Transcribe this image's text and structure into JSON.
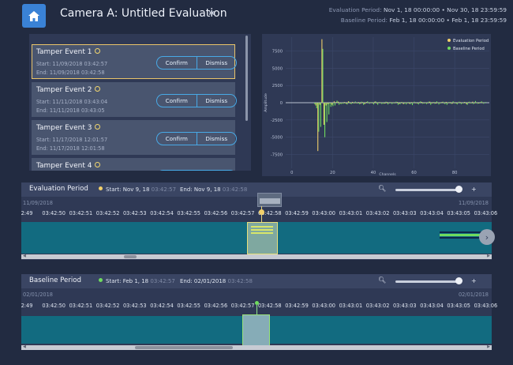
{
  "title": "Camera A: Untitled Evaluation",
  "header": {
    "eval_label": "Evaluation Period:",
    "eval_value": "Nov 1, 18  00:00:00  •  Nov 30, 18  23:59:59",
    "base_label": "Baseline Period:",
    "base_value": "Feb 1, 18  00:00:00  •  Feb 1, 18  23:59:59"
  },
  "events": [
    {
      "title": "Tamper Event 1",
      "start": "Start: 11/09/2018 03:42:57",
      "end": "End:   11/09/2018 03:42:58",
      "confirm": "Confirm",
      "dismiss": "Dismiss",
      "selected": true
    },
    {
      "title": "Tamper Event 2",
      "start": "Start: 11/11/2018 03:43:04",
      "end": "End:   11/11/2018 03:43:05",
      "confirm": "Confirm",
      "dismiss": "Dismiss",
      "selected": false
    },
    {
      "title": "Tamper Event 3",
      "start": "Start: 11/17/2018 12:01:57",
      "end": "End:   11/17/2018 12:01:58",
      "confirm": "Confirm",
      "dismiss": "Dismiss",
      "selected": false
    },
    {
      "title": "Tamper Event 4",
      "start": "",
      "end": "",
      "confirm": "",
      "dismiss": "",
      "selected": false
    }
  ],
  "chart_data": {
    "type": "bar",
    "xlabel": "Channels",
    "ylabel": "Amplitude",
    "xlim": [
      -3,
      97
    ],
    "ylim": [
      -9500,
      9500
    ],
    "xticks": [
      0,
      20,
      40,
      60,
      80
    ],
    "yticks": [
      -7500,
      -5000,
      -2500,
      0,
      2500,
      5000,
      7500
    ],
    "legend_position": "top-right",
    "series": [
      {
        "name": "Evaluation Period",
        "color": "#f2d06b",
        "values": [
          0,
          0,
          0,
          0,
          0,
          0,
          0,
          0,
          0,
          0,
          0,
          0,
          -400,
          -7000,
          -300,
          9200,
          -3200,
          -400,
          -200,
          -100,
          -300,
          200,
          100,
          150,
          -100,
          -50,
          100,
          -150,
          200,
          -100,
          120,
          -80,
          -60,
          100,
          -150,
          80,
          -200,
          100,
          -50,
          60,
          -80,
          150,
          -100,
          80,
          60,
          -50,
          -120,
          100,
          -80,
          60,
          40,
          -60,
          100,
          -150,
          80,
          -200,
          60,
          -40,
          -150,
          80,
          50,
          -60,
          -100,
          80,
          120,
          -80,
          40,
          -60,
          150,
          -100,
          80,
          -120,
          60,
          -40,
          100,
          -80,
          120,
          -60,
          80,
          -150,
          60,
          -100,
          40,
          80,
          -60,
          100,
          -200,
          80,
          -50,
          150,
          -80,
          60,
          -100,
          80,
          40
        ]
      },
      {
        "name": "Baseline Period",
        "color": "#6fdc5e",
        "values": [
          0,
          0,
          0,
          0,
          0,
          0,
          0,
          0,
          0,
          0,
          0,
          -200,
          -800,
          -4200,
          -3500,
          7800,
          -5000,
          -2800,
          -1700,
          -600,
          -500,
          -400,
          300,
          -300,
          -200,
          -150,
          -100,
          -250,
          150,
          -200,
          -100,
          180,
          -120,
          -200,
          150,
          -300,
          -100,
          200,
          -150,
          100,
          -250,
          200,
          -300,
          100,
          -200,
          -150,
          150,
          -250,
          100,
          -200,
          -100,
          150,
          -300,
          -200,
          100,
          -150,
          -250,
          100,
          -200,
          -350,
          150,
          -100,
          -250,
          200,
          -150,
          -100,
          -200,
          150,
          -300,
          100,
          -150,
          200,
          -250,
          -100,
          150,
          -200,
          -300,
          100,
          -150,
          200,
          -100,
          -250,
          150,
          -200,
          -100,
          100,
          -300,
          150,
          -100,
          -200,
          250,
          -150,
          -100,
          200,
          -150,
          100
        ]
      }
    ]
  },
  "timeline_eval": {
    "title": "Evaluation Period",
    "start_label": "Start:",
    "start_date": "Nov 9, 18",
    "start_time": "03:42:57",
    "end_label": "End:",
    "end_date": "Nov 9, 18",
    "end_time": "03:42:58",
    "date_left": "11/09/2018",
    "date_right": "11/09/2018",
    "ticks": [
      "2:49",
      "03:42:50",
      "03:42:51",
      "03:42:52",
      "03:42:53",
      "03:42:54",
      "03:42:55",
      "03:42:56",
      "03:42:57",
      "03:42:58",
      "03:42:59",
      "03:43:00",
      "03:43:01",
      "03:43:02",
      "03:43:03",
      "03:43:04",
      "03:43:05",
      "03:43:06"
    ],
    "dot_color": "#f2d06b"
  },
  "timeline_base": {
    "title": "Baseline Period",
    "start_label": "Start:",
    "start_date": "Feb 1, 18",
    "start_time": "03:42:57",
    "end_label": "End:",
    "end_date": "02/01/2018",
    "end_time": "03:42:58",
    "date_left": "02/01/2018",
    "date_right": "02/01/2018",
    "ticks": [
      "2:49",
      "03:42:50",
      "03:42:51",
      "03:42:52",
      "03:42:53",
      "03:42:54",
      "03:42:55",
      "03:42:56",
      "03:42:57",
      "03:42:58",
      "03:42:59",
      "03:43:00",
      "03:43:01",
      "03:43:02",
      "03:43:03",
      "03:43:04",
      "03:43:05",
      "03:43:06"
    ],
    "dot_color": "#6fdc5e"
  }
}
